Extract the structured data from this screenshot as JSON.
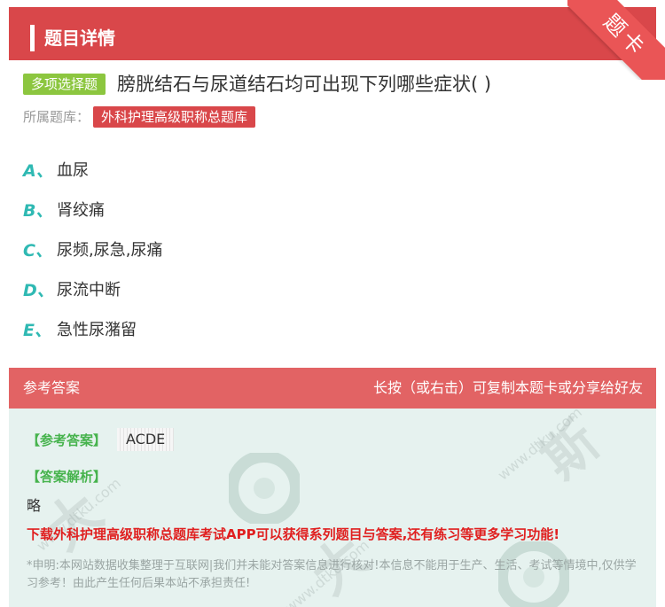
{
  "header": {
    "title": "题目详情",
    "ribbon": "题卡"
  },
  "question": {
    "type_badge": "多项选择题",
    "text": "膀胱结石与尿道结石均可出现下列哪些症状( )",
    "bank_label": "所属题库：",
    "bank_name": "外科护理高级职称总题库"
  },
  "options": [
    {
      "letter": "A、",
      "text": "血尿"
    },
    {
      "letter": "B、",
      "text": "肾绞痛"
    },
    {
      "letter": "C、",
      "text": "尿频,尿急,尿痛"
    },
    {
      "letter": "D、",
      "text": "尿流中断"
    },
    {
      "letter": "E、",
      "text": "急性尿潴留"
    }
  ],
  "answer_section": {
    "title": "参考答案",
    "hint": "长按（或右击）可复制本题卡或分享给好友",
    "answer_label": "【参考答案】",
    "answer_value": "ACDE",
    "explanation_label": "【答案解析】",
    "explanation_text": "略",
    "promo_text": "下载外科护理高级职称总题库考试APP可以获得系列题目与答案,还有练习等更多学习功能!",
    "disclaimer": "*申明:本网站数据收集整理于互联网|我们并未能对答案信息进行核对!本信息不能用于生产、生活、考试等情境中,仅供学习参考！由此产生任何后果本站不承担责任!"
  },
  "colors": {
    "header_red": "#d9474a",
    "answer_head": "#e26364",
    "answer_bg": "#e6f2ef",
    "badge_green": "#8cc63f",
    "option_letter": "#2fb9b3",
    "label_green": "#46b34d",
    "promo_red": "#e02020"
  }
}
